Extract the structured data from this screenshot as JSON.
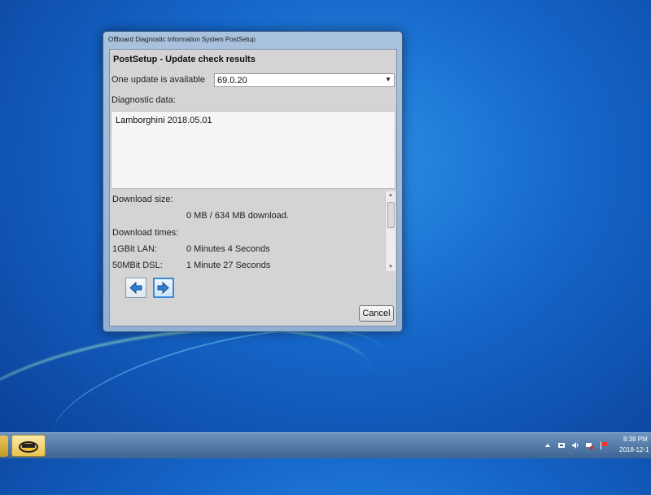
{
  "window": {
    "title": "Offboard Diagnostic Information System PostSetup",
    "heading": "PostSetup - Update check results",
    "update_label": "One update is available",
    "update_select_value": "69.0.20",
    "diagnostic_label": "Diagnostic data:",
    "diagnostic_entry": "Lamborghini 2018.05.01",
    "download_size_label": "Download size:",
    "download_size_value": "0 MB / 634 MB download.",
    "download_times_label": "Download times:",
    "lan_label": "1GBit LAN:",
    "lan_value": "0 Minutes 4 Seconds",
    "dsl_label": "50MBit DSL:",
    "dsl_value": "1 Minute 27 Seconds",
    "cancel_label": "Cancel"
  },
  "taskbar": {
    "clock_time": "8:38 PM",
    "clock_date": "2018-12-1"
  },
  "colors": {
    "accent": "#3b89d8",
    "arrow_blue": "#2f7fd4"
  }
}
